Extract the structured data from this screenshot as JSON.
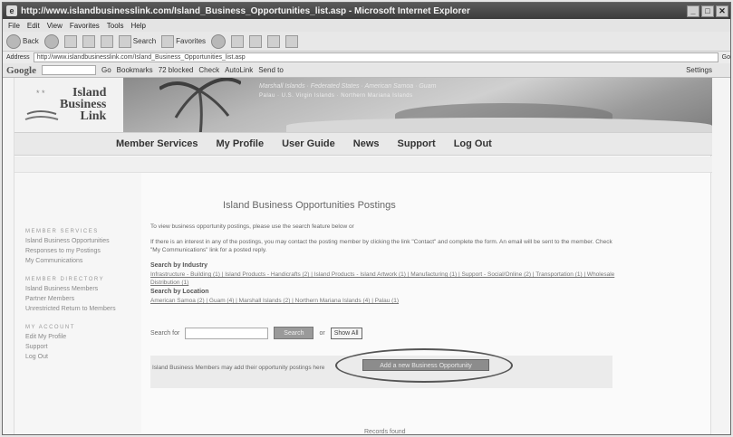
{
  "window": {
    "title": "http://www.islandbusinesslink.com/Island_Business_Opportunities_list.asp - Microsoft Internet Explorer"
  },
  "menu": [
    "File",
    "Edit",
    "View",
    "Favorites",
    "Tools",
    "Help"
  ],
  "toolbar": {
    "back": "Back",
    "search": "Search",
    "favorites": "Favorites"
  },
  "address": {
    "label": "Address",
    "url": "http://www.islandbusinesslink.com/Island_Business_Opportunities_list.asp",
    "go": "Go"
  },
  "googlebar": {
    "logo": "Google",
    "go_label": "Go",
    "bookmarks": "Bookmarks",
    "blocked": "72 blocked",
    "check": "Check",
    "autolink": "AutoLink",
    "sendto": "Send to",
    "settings": "Settings"
  },
  "site": {
    "logo_lines": [
      "Island",
      "Business",
      "Link"
    ],
    "banner_caption": "Marshall Islands · Federated States · American Samoa · Guam",
    "banner_caption2": "Palau · U.S. Virgin Islands · Northern Mariana Islands"
  },
  "nav": [
    "Member Services",
    "My Profile",
    "User Guide",
    "News",
    "Support",
    "Log Out"
  ],
  "sidebar": {
    "groups": [
      {
        "heading": "MEMBER SERVICES",
        "links": [
          "Island Business Opportunities",
          "Responses to my Postings",
          "My Communications"
        ]
      },
      {
        "heading": "MEMBER DIRECTORY",
        "links": [
          "Island Business Members",
          "Partner Members",
          "Unrestricted Return to Members"
        ]
      },
      {
        "heading": "MY ACCOUNT",
        "links": [
          "Edit My Profile",
          "Support",
          "Log Out"
        ]
      }
    ]
  },
  "main": {
    "heading": "Island Business Opportunities Postings",
    "intro": "To view business opportunity postings, please use the search feature below or",
    "desc": "If there is an interest in any of the postings, you may contact the posting member by clicking the link \"Contact\" and complete the form. An email will be sent to the member. Check \"My Communications\" link for a posted reply.",
    "industry_label": "Search by Industry",
    "industry_links": "Infrastructure - Building (1) | Island Products - Handicrafts (2) | Island Products - Island Artwork (1) | Manufacturing (1) | Support - Social/Online (2) | Transportation (1) | Wholesale Distribution (1)",
    "location_label": "Search by Location",
    "location_links": "American Samoa (2) | Guam (4) | Marshall Islands (2) | Northern Mariana Islands (4) | Palau (1)",
    "search_label": "Search for",
    "search_button": "Search",
    "or_text": "or",
    "show_all": "Show All",
    "add_text": "Island Business Members may add their opportunity postings here",
    "add_button": "Add a new Business Opportunity",
    "records": "Records found"
  }
}
